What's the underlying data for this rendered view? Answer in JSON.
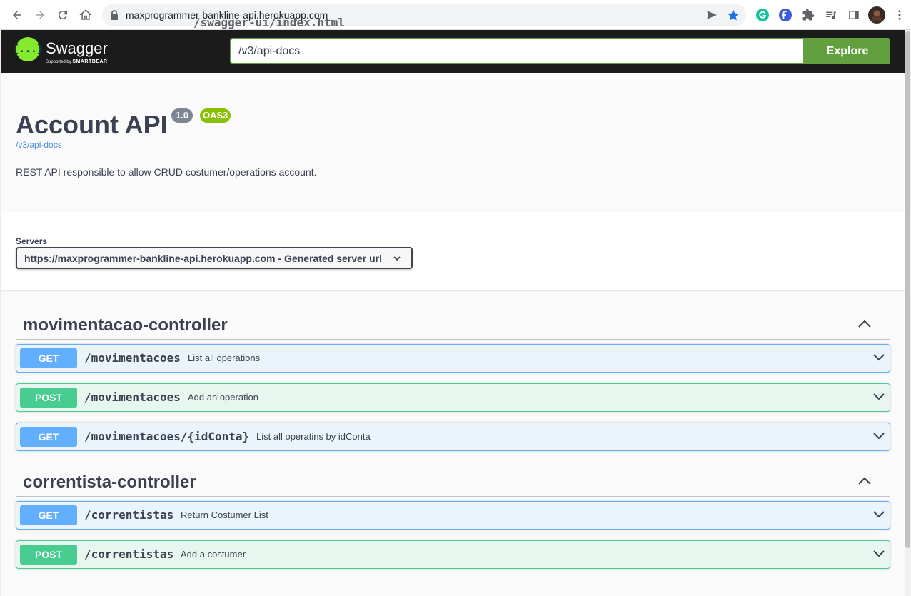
{
  "browser": {
    "url_host": "maxprogrammer-bankline-api.herokuapp.com",
    "url_path": "/swagger-ui/index.html"
  },
  "topbar": {
    "logo_text": "Swagger",
    "logo_symbol": "{...}",
    "logo_sub_prefix": "Supported by",
    "logo_sub_brand": "SMARTBEAR",
    "explore_value": "/v3/api-docs",
    "explore_label": "Explore"
  },
  "info": {
    "title": "Account API",
    "version": "1.0",
    "oas": "OAS3",
    "doc_link": "/v3/api-docs",
    "description": "REST API responsible to allow CRUD costumer/operations account."
  },
  "servers": {
    "label": "Servers",
    "selected": "https://maxprogrammer-bankline-api.herokuapp.com - Generated server url"
  },
  "tags": [
    {
      "name": "movimentacao-controller",
      "operations": [
        {
          "method": "GET",
          "path": "/movimentacoes",
          "summary": "List all operations"
        },
        {
          "method": "POST",
          "path": "/movimentacoes",
          "summary": "Add an operation"
        },
        {
          "method": "GET",
          "path": "/movimentacoes/{idConta}",
          "summary": "List all operatins by idConta"
        }
      ]
    },
    {
      "name": "correntista-controller",
      "operations": [
        {
          "method": "GET",
          "path": "/correntistas",
          "summary": "Return Costumer List"
        },
        {
          "method": "POST",
          "path": "/correntistas",
          "summary": "Add a costumer"
        }
      ]
    }
  ],
  "colors": {
    "get": "#61affe",
    "post": "#49cc90",
    "explore": "#62a03f",
    "topbar": "#1b1b1b"
  },
  "icons": {
    "back": "arrow-left-icon",
    "forward": "arrow-right-icon",
    "reload": "reload-icon",
    "home": "home-icon",
    "lock": "lock-icon",
    "send": "send-icon",
    "bookmark": "star-icon",
    "extensions": [
      "grammarly-icon",
      "flow-icon",
      "puzzle-icon",
      "media-queue-icon",
      "side-panel-icon",
      "avatar",
      "kebab-menu-icon"
    ]
  }
}
